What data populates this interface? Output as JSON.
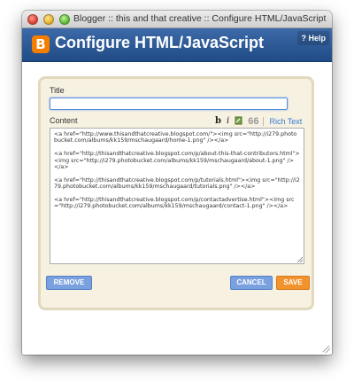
{
  "window": {
    "title": "Blogger :: this and that creative :: Configure HTML/JavaScript"
  },
  "header": {
    "logo_letter": "B",
    "title": "Configure HTML/JavaScript",
    "help_label": "? Help"
  },
  "form": {
    "title_label": "Title",
    "title_value": "",
    "content_label": "Content",
    "toolbar": {
      "bold": "b",
      "italic": "i",
      "quote": "66",
      "rich_text": "Rich Text"
    },
    "content_lines": [
      "<a href=\"http://www.thisandthatcreative.blogspot.com/\"><img src=\"http://i279.photobucket.com/albums/kk159/mschaugaard/home-1.png\" /></a>",
      "<a href=\"http://thisandthatcreative.blogspot.com/p/about-this-that-contributors.html\"><img src=\"http://i279.photobucket.com/albums/kk159/mschaugaard/about-1.png\" /></a>",
      "<a href=\"http://thisandthatcreative.blogspot.com/p/tutorials.html\"><img src=\"http://i279.photobucket.com/albums/kk159/mschaugaard/tutorials.png\" /></a>",
      "<a href=\"http://thisandthatcreative.blogspot.com/p/contactadvertise.html\"><img src=\"http://i279.photobucket.com/albums/kk159/mschaugaard/contact-1.png\" /></a>"
    ]
  },
  "buttons": {
    "remove": "REMOVE",
    "cancel": "CANCEL",
    "save": "SAVE"
  },
  "colors": {
    "header_blue": "#2a5794",
    "panel_bg": "#f6f1e1",
    "button_blue": "#7aa1df",
    "save_orange": "#f2932e"
  }
}
